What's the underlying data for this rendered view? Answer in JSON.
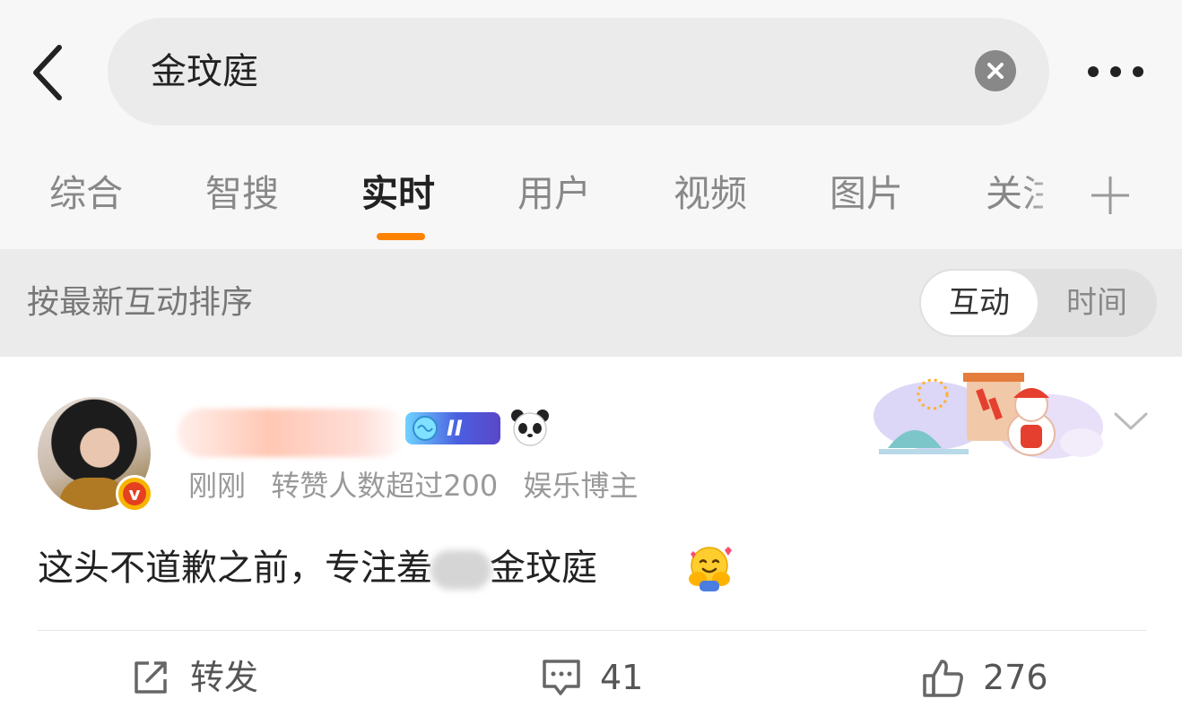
{
  "search": {
    "query": "金玟庭"
  },
  "tabs": [
    {
      "label": "综合"
    },
    {
      "label": "智搜"
    },
    {
      "label": "实时"
    },
    {
      "label": "用户"
    },
    {
      "label": "视频"
    },
    {
      "label": "图片"
    },
    {
      "label": "关注"
    }
  ],
  "active_tab": "实时",
  "sort": {
    "label": "按最新互动排序",
    "options": [
      "互动",
      "时间"
    ],
    "selected": "互动"
  },
  "post": {
    "level_badge": "II",
    "meta": {
      "time": "刚刚",
      "reposts_note": "转赞人数超过200",
      "tag": "娱乐博主"
    },
    "text_before": "这头不道歉之前，专注羞",
    "text_after": "金玟庭",
    "actions": {
      "repost_label": "转发",
      "comments_count": "41",
      "likes_count": "276"
    }
  },
  "colors": {
    "accent": "#ff8200",
    "verified_badge": "#f7b500",
    "page_bg": "#f7f7f7"
  },
  "icons": [
    "back-arrow-icon",
    "clear-icon",
    "more-icon",
    "plus-icon",
    "verified-v-icon",
    "panda-icon",
    "chevron-down-icon",
    "repost-icon",
    "comment-icon",
    "like-icon",
    "hug-emoji-icon"
  ]
}
